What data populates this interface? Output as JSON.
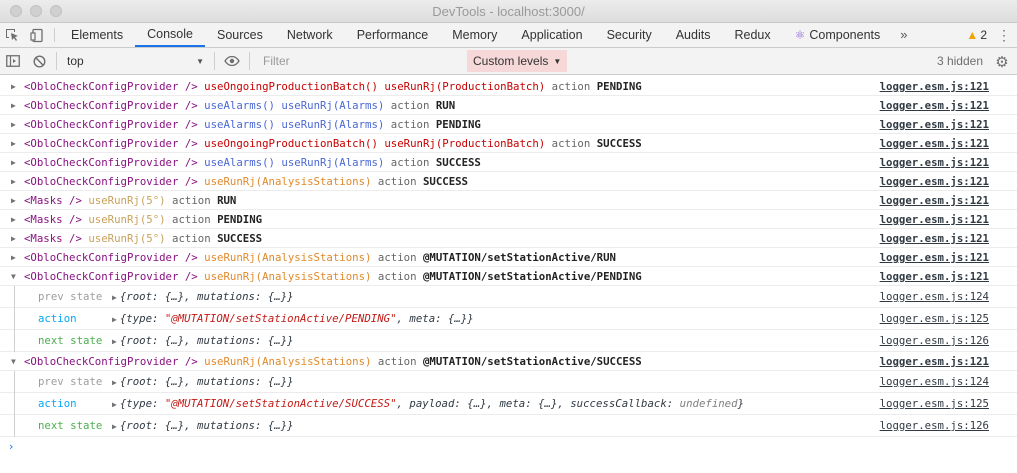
{
  "window": {
    "title": "DevTools - localhost:3000/"
  },
  "tabs": [
    {
      "label": "Elements"
    },
    {
      "label": "Console",
      "active": true
    },
    {
      "label": "Sources"
    },
    {
      "label": "Network"
    },
    {
      "label": "Performance"
    },
    {
      "label": "Memory"
    },
    {
      "label": "Application"
    },
    {
      "label": "Security"
    },
    {
      "label": "Audits"
    },
    {
      "label": "Redux"
    },
    {
      "label": "Components",
      "icon": "react-icon"
    }
  ],
  "tabbar": {
    "more_label": "»",
    "warning_count": "2"
  },
  "toolbar": {
    "context_value": "top",
    "filter_placeholder": "Filter",
    "levels_label": "Custom levels",
    "hidden_label": "3 hidden"
  },
  "colors": {
    "component": "#881280",
    "hook_red": "#c80000",
    "hook_blue": "#4a67d6",
    "hook_orange": "#e08a2b",
    "hook_tan": "#c9a15a",
    "grey": "#666666",
    "action_blue": "#03a9f4",
    "next_green": "#4caf50",
    "prev_grey": "#9e9e9e",
    "string_red": "#c41a16",
    "accent": "#1a73e8"
  },
  "messages": [
    {
      "type": "log",
      "expanded": false,
      "parts": [
        {
          "text": "<ObloCheckConfigProvider />",
          "color": "#881280"
        },
        {
          "text": "useOngoingProductionBatch()",
          "color": "#c80000"
        },
        {
          "text": "useRunRj(ProductionBatch)",
          "color": "#c80000"
        },
        {
          "text": "action",
          "color": "#666666"
        },
        {
          "text": "PENDING",
          "color": "#222222",
          "bold": true
        }
      ],
      "source": "logger.esm.js:121"
    },
    {
      "type": "log",
      "expanded": false,
      "parts": [
        {
          "text": "<ObloCheckConfigProvider />",
          "color": "#881280"
        },
        {
          "text": "useAlarms()",
          "color": "#4a67d6"
        },
        {
          "text": "useRunRj(Alarms)",
          "color": "#4a67d6"
        },
        {
          "text": "action",
          "color": "#666666"
        },
        {
          "text": "RUN",
          "color": "#222222",
          "bold": true
        }
      ],
      "source": "logger.esm.js:121"
    },
    {
      "type": "log",
      "expanded": false,
      "parts": [
        {
          "text": "<ObloCheckConfigProvider />",
          "color": "#881280"
        },
        {
          "text": "useAlarms()",
          "color": "#4a67d6"
        },
        {
          "text": "useRunRj(Alarms)",
          "color": "#4a67d6"
        },
        {
          "text": "action",
          "color": "#666666"
        },
        {
          "text": "PENDING",
          "color": "#222222",
          "bold": true
        }
      ],
      "source": "logger.esm.js:121"
    },
    {
      "type": "log",
      "expanded": false,
      "parts": [
        {
          "text": "<ObloCheckConfigProvider />",
          "color": "#881280"
        },
        {
          "text": "useOngoingProductionBatch()",
          "color": "#c80000"
        },
        {
          "text": "useRunRj(ProductionBatch)",
          "color": "#c80000"
        },
        {
          "text": "action",
          "color": "#666666"
        },
        {
          "text": "SUCCESS",
          "color": "#222222",
          "bold": true
        }
      ],
      "source": "logger.esm.js:121"
    },
    {
      "type": "log",
      "expanded": false,
      "parts": [
        {
          "text": "<ObloCheckConfigProvider />",
          "color": "#881280"
        },
        {
          "text": "useAlarms()",
          "color": "#4a67d6"
        },
        {
          "text": "useRunRj(Alarms)",
          "color": "#4a67d6"
        },
        {
          "text": "action",
          "color": "#666666"
        },
        {
          "text": "SUCCESS",
          "color": "#222222",
          "bold": true
        }
      ],
      "source": "logger.esm.js:121"
    },
    {
      "type": "log",
      "expanded": false,
      "parts": [
        {
          "text": "<ObloCheckConfigProvider />",
          "color": "#881280"
        },
        {
          "text": "useRunRj(AnalysisStations)",
          "color": "#e08a2b"
        },
        {
          "text": "action",
          "color": "#666666"
        },
        {
          "text": "SUCCESS",
          "color": "#222222",
          "bold": true
        }
      ],
      "source": "logger.esm.js:121"
    },
    {
      "type": "log",
      "expanded": false,
      "parts": [
        {
          "text": "<Masks />",
          "color": "#881280"
        },
        {
          "text": "useRunRj(5°)",
          "color": "#c9a15a"
        },
        {
          "text": "action",
          "color": "#666666"
        },
        {
          "text": "RUN",
          "color": "#222222",
          "bold": true
        }
      ],
      "source": "logger.esm.js:121"
    },
    {
      "type": "log",
      "expanded": false,
      "parts": [
        {
          "text": "<Masks />",
          "color": "#881280"
        },
        {
          "text": "useRunRj(5°)",
          "color": "#c9a15a"
        },
        {
          "text": "action",
          "color": "#666666"
        },
        {
          "text": "PENDING",
          "color": "#222222",
          "bold": true
        }
      ],
      "source": "logger.esm.js:121"
    },
    {
      "type": "log",
      "expanded": false,
      "parts": [
        {
          "text": "<Masks />",
          "color": "#881280"
        },
        {
          "text": "useRunRj(5°)",
          "color": "#c9a15a"
        },
        {
          "text": "action",
          "color": "#666666"
        },
        {
          "text": "SUCCESS",
          "color": "#222222",
          "bold": true
        }
      ],
      "source": "logger.esm.js:121"
    },
    {
      "type": "log",
      "expanded": false,
      "parts": [
        {
          "text": "<ObloCheckConfigProvider />",
          "color": "#881280"
        },
        {
          "text": "useRunRj(AnalysisStations)",
          "color": "#e08a2b"
        },
        {
          "text": "action",
          "color": "#666666"
        },
        {
          "text": "@MUTATION/setStationActive/RUN",
          "color": "#222222",
          "bold": true
        }
      ],
      "source": "logger.esm.js:121"
    },
    {
      "type": "log",
      "expanded": true,
      "parts": [
        {
          "text": "<ObloCheckConfigProvider />",
          "color": "#881280"
        },
        {
          "text": "useRunRj(AnalysisStations)",
          "color": "#e08a2b"
        },
        {
          "text": "action",
          "color": "#666666"
        },
        {
          "text": "@MUTATION/setStationActive/PENDING",
          "color": "#222222",
          "bold": true
        }
      ],
      "source": "logger.esm.js:121"
    },
    {
      "type": "sub",
      "label": "prev state",
      "label_color": "#9e9e9e",
      "object": [
        {
          "text": "{root: {…}, mutations: {…}}",
          "color": "#303942"
        }
      ],
      "source": "logger.esm.js:124"
    },
    {
      "type": "sub",
      "label": "action",
      "label_color": "#03a9f4",
      "object": [
        {
          "text": "{type: ",
          "color": "#303942"
        },
        {
          "text": "\"@MUTATION/setStationActive/PENDING\"",
          "color": "#c41a16"
        },
        {
          "text": ", meta: {…}}",
          "color": "#303942"
        }
      ],
      "source": "logger.esm.js:125"
    },
    {
      "type": "sub",
      "label": "next state",
      "label_color": "#4caf50",
      "object": [
        {
          "text": "{root: {…}, mutations: {…}}",
          "color": "#303942"
        }
      ],
      "source": "logger.esm.js:126"
    },
    {
      "type": "log",
      "expanded": true,
      "parts": [
        {
          "text": "<ObloCheckConfigProvider />",
          "color": "#881280"
        },
        {
          "text": "useRunRj(AnalysisStations)",
          "color": "#e08a2b"
        },
        {
          "text": "action",
          "color": "#666666"
        },
        {
          "text": "@MUTATION/setStationActive/SUCCESS",
          "color": "#222222",
          "bold": true
        }
      ],
      "source": "logger.esm.js:121"
    },
    {
      "type": "sub",
      "label": "prev state",
      "label_color": "#9e9e9e",
      "object": [
        {
          "text": "{root: {…}, mutations: {…}}",
          "color": "#303942"
        }
      ],
      "source": "logger.esm.js:124"
    },
    {
      "type": "sub",
      "label": "action",
      "label_color": "#03a9f4",
      "object": [
        {
          "text": "{type: ",
          "color": "#303942"
        },
        {
          "text": "\"@MUTATION/setStationActive/SUCCESS\"",
          "color": "#c41a16"
        },
        {
          "text": ", payload: {…}, meta: {…}, successCallback: ",
          "color": "#303942"
        },
        {
          "text": "undefined",
          "color": "#808080"
        },
        {
          "text": "}",
          "color": "#303942"
        }
      ],
      "source": "logger.esm.js:125"
    },
    {
      "type": "sub",
      "label": "next state",
      "label_color": "#4caf50",
      "object": [
        {
          "text": "{root: {…}, mutations: {…}}",
          "color": "#303942"
        }
      ],
      "source": "logger.esm.js:126"
    }
  ]
}
